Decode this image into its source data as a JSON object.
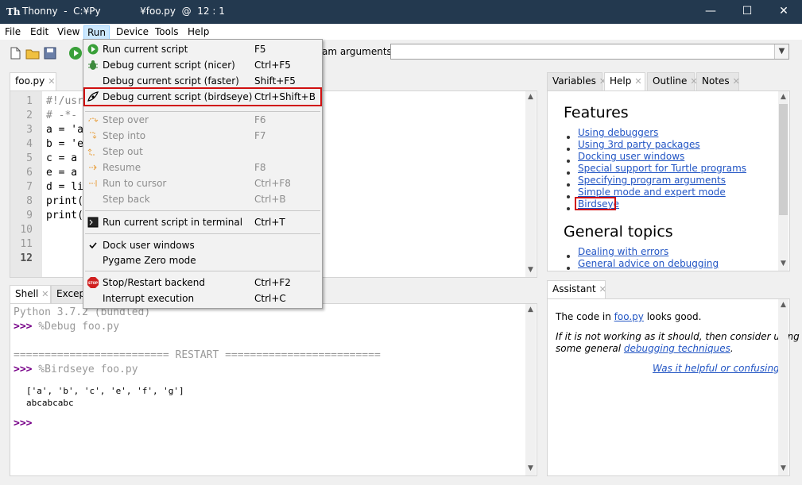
{
  "window": {
    "title": "Thonny  -  C:¥Py             ¥foo.py  @  12 : 1",
    "minimize": "—",
    "maximize": "☐",
    "close": "✕"
  },
  "menubar": [
    "File",
    "Edit",
    "View",
    "Run",
    "Device",
    "Tools",
    "Help"
  ],
  "toolbar": {
    "args_label": "am arguments:",
    "args_value": ""
  },
  "editor": {
    "tab": "foo.py",
    "line_numbers": [
      "1",
      "2",
      "3",
      "4",
      "5",
      "6",
      "7",
      "8",
      "9",
      "10",
      "11",
      "12"
    ],
    "lines": [
      "#!/usr",
      "# -*-",
      "a = 'a",
      "b = 'e",
      "c = a",
      "e = a",
      "d = li",
      "print(",
      "print(",
      "",
      "",
      ""
    ]
  },
  "shell": {
    "tabs": [
      "Shell",
      "Except"
    ],
    "version": "Python 3.7.2 (bundled)",
    "prompt": ">>>",
    "cmd1": " %Debug foo.py",
    "restart": "========================= RESTART =========================",
    "cmd2": " %Birdseye foo.py",
    "output1": "['a', 'b', 'c', 'e', 'f', 'g']",
    "output2": "abcabcabc"
  },
  "right_tabs": [
    "Variables",
    "Help",
    "Outline",
    "Notes"
  ],
  "help": {
    "features_title": "Features",
    "features": [
      "Using debuggers",
      "Using 3rd party packages",
      "Docking user windows",
      "Special support for Turtle programs",
      "Specifying program arguments",
      "Simple mode and expert mode",
      "Birdseye"
    ],
    "general_title": "General topics",
    "general": [
      "Dealing with errors",
      "General advice on debugging"
    ]
  },
  "assistant": {
    "tab": "Assistant",
    "line1_pre": "The code in ",
    "line1_link": "foo.py",
    "line1_post": " looks good.",
    "line2": "If it is not working as it should, then consider using",
    "line3_pre": "some general ",
    "line3_link": "debugging techniques",
    "line3_post": ".",
    "feedback": "Was it helpful or confusing?"
  },
  "run_menu": [
    {
      "label": "Run current script",
      "shortcut": "F5",
      "icon": "run-icon",
      "disabled": false
    },
    {
      "label": "Debug current script (nicer)",
      "shortcut": "Ctrl+F5",
      "icon": "bug-icon",
      "disabled": false
    },
    {
      "label": "Debug current script (faster)",
      "shortcut": "Shift+F5",
      "icon": "",
      "disabled": false
    },
    {
      "label": "Debug current script (birdseye)",
      "shortcut": "Ctrl+Shift+B",
      "icon": "birdseye-icon",
      "disabled": false
    },
    {
      "label": "Step over",
      "shortcut": "F6",
      "icon": "step-over-icon",
      "disabled": true
    },
    {
      "label": "Step into",
      "shortcut": "F7",
      "icon": "step-into-icon",
      "disabled": true
    },
    {
      "label": "Step out",
      "shortcut": "",
      "icon": "step-out-icon",
      "disabled": true
    },
    {
      "label": "Resume",
      "shortcut": "F8",
      "icon": "resume-icon",
      "disabled": true
    },
    {
      "label": "Run to cursor",
      "shortcut": "Ctrl+F8",
      "icon": "run-to-cursor-icon",
      "disabled": true
    },
    {
      "label": "Step back",
      "shortcut": "Ctrl+B",
      "icon": "",
      "disabled": true
    },
    {
      "label": "Run current script in terminal",
      "shortcut": "Ctrl+T",
      "icon": "terminal-icon",
      "disabled": false
    },
    {
      "label": "Dock user windows",
      "shortcut": "",
      "icon": "check-icon",
      "disabled": false
    },
    {
      "label": "Pygame Zero mode",
      "shortcut": "",
      "icon": "",
      "disabled": false
    },
    {
      "label": "Stop/Restart backend",
      "shortcut": "Ctrl+F2",
      "icon": "stop-icon",
      "disabled": false
    },
    {
      "label": "Interrupt execution",
      "shortcut": "Ctrl+C",
      "icon": "",
      "disabled": false
    }
  ],
  "colors": {
    "titlebar": "#23394f",
    "link": "#2255c4",
    "highlight": "#d01010",
    "prompt": "#770088"
  }
}
